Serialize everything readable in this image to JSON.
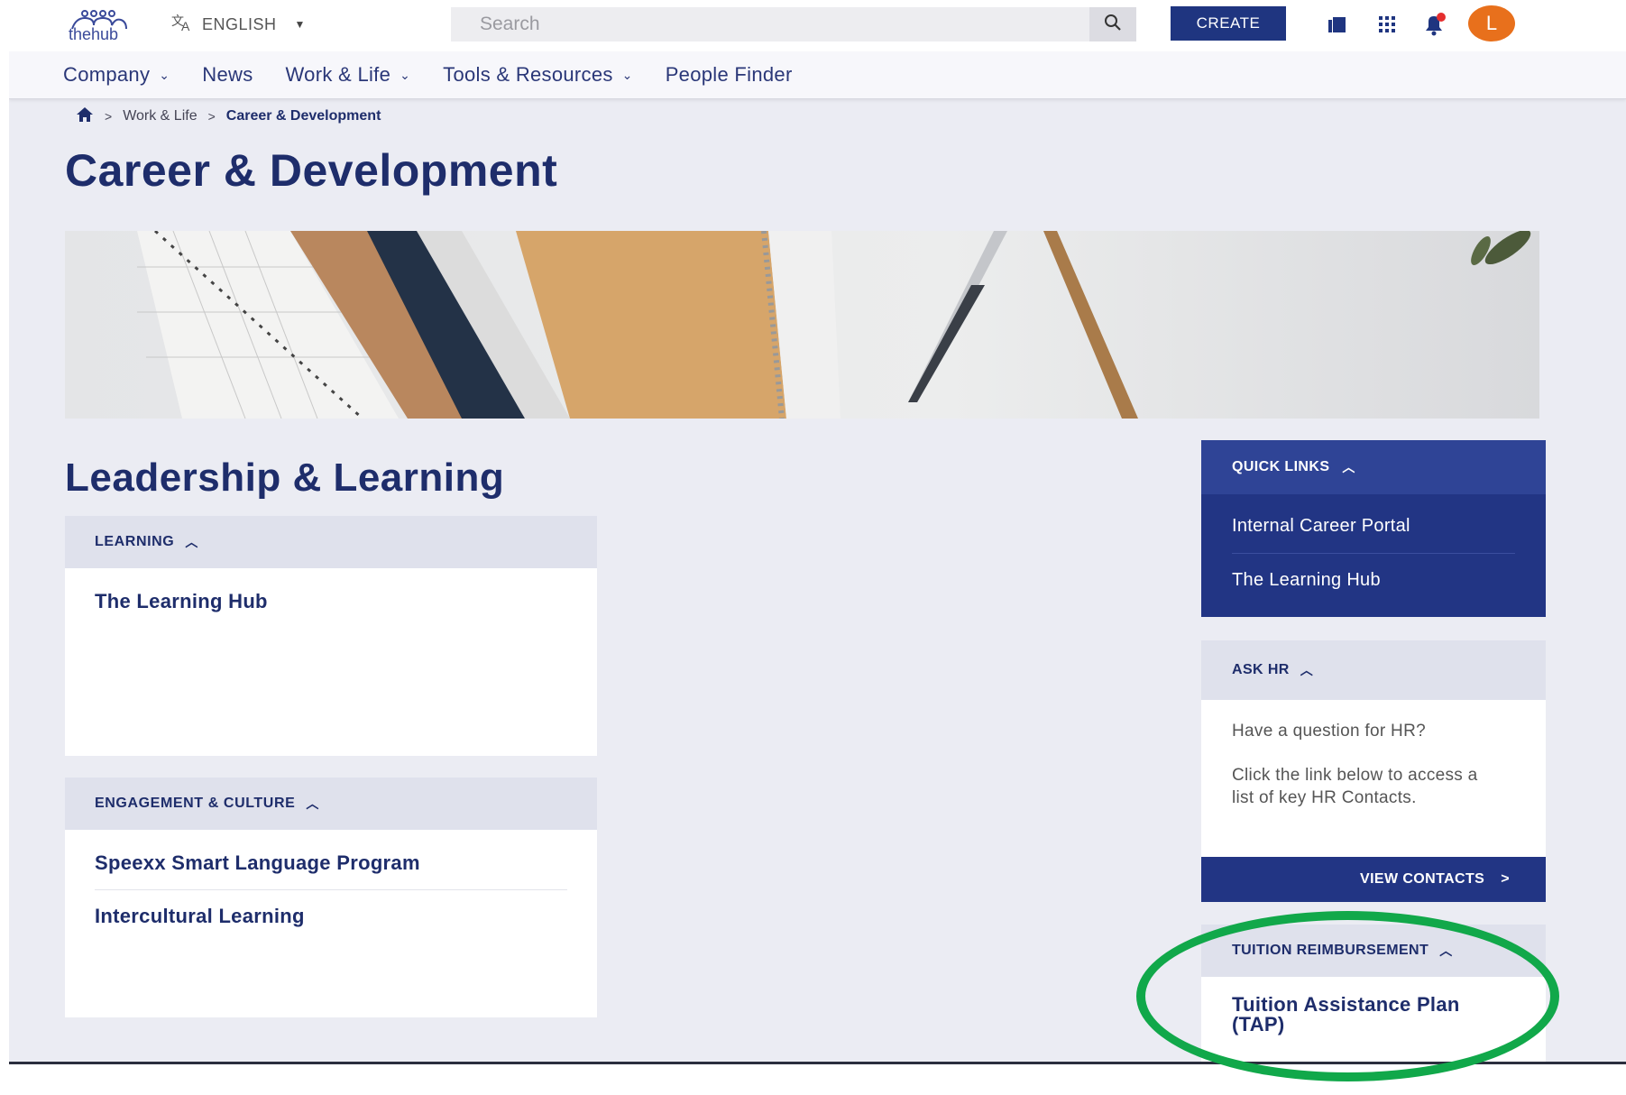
{
  "header": {
    "logo_text": "thehub",
    "language": "ENGLISH",
    "search_placeholder": "Search",
    "create_label": "CREATE",
    "avatar_initial": "L",
    "icons": [
      "translate-icon",
      "search-icon",
      "library-icon",
      "apps-grid-icon",
      "bell-icon"
    ]
  },
  "nav": {
    "items": [
      {
        "label": "Company",
        "has_dropdown": true
      },
      {
        "label": "News",
        "has_dropdown": false
      },
      {
        "label": "Work & Life",
        "has_dropdown": true
      },
      {
        "label": "Tools & Resources",
        "has_dropdown": true
      },
      {
        "label": "People Finder",
        "has_dropdown": false
      }
    ]
  },
  "breadcrumb": {
    "items": [
      "Work & Life",
      "Career & Development"
    ]
  },
  "page": {
    "title": "Career & Development",
    "section_title": "Leadership & Learning"
  },
  "cards": {
    "learning": {
      "header": "LEARNING",
      "links": [
        "The Learning Hub"
      ]
    },
    "engagement": {
      "header": "ENGAGEMENT & CULTURE",
      "links": [
        "Speexx Smart Language Program",
        "Intercultural Learning"
      ]
    }
  },
  "sidebar": {
    "quick_links": {
      "header": "QUICK LINKS",
      "links": [
        "Internal Career Portal",
        "The Learning Hub"
      ]
    },
    "ask_hr": {
      "header": "ASK HR",
      "question": "Have a question for HR?",
      "body": "Click the link below to access a list of key HR Contacts.",
      "button": "VIEW CONTACTS"
    },
    "tuition": {
      "header": "TUITION REIMBURSEMENT",
      "link": "Tuition Assistance Plan (TAP)"
    }
  },
  "colors": {
    "brand_navy": "#1f3580",
    "accent_orange": "#e8701c",
    "highlight_green": "#11a84a",
    "page_bg": "#ebecf3"
  }
}
